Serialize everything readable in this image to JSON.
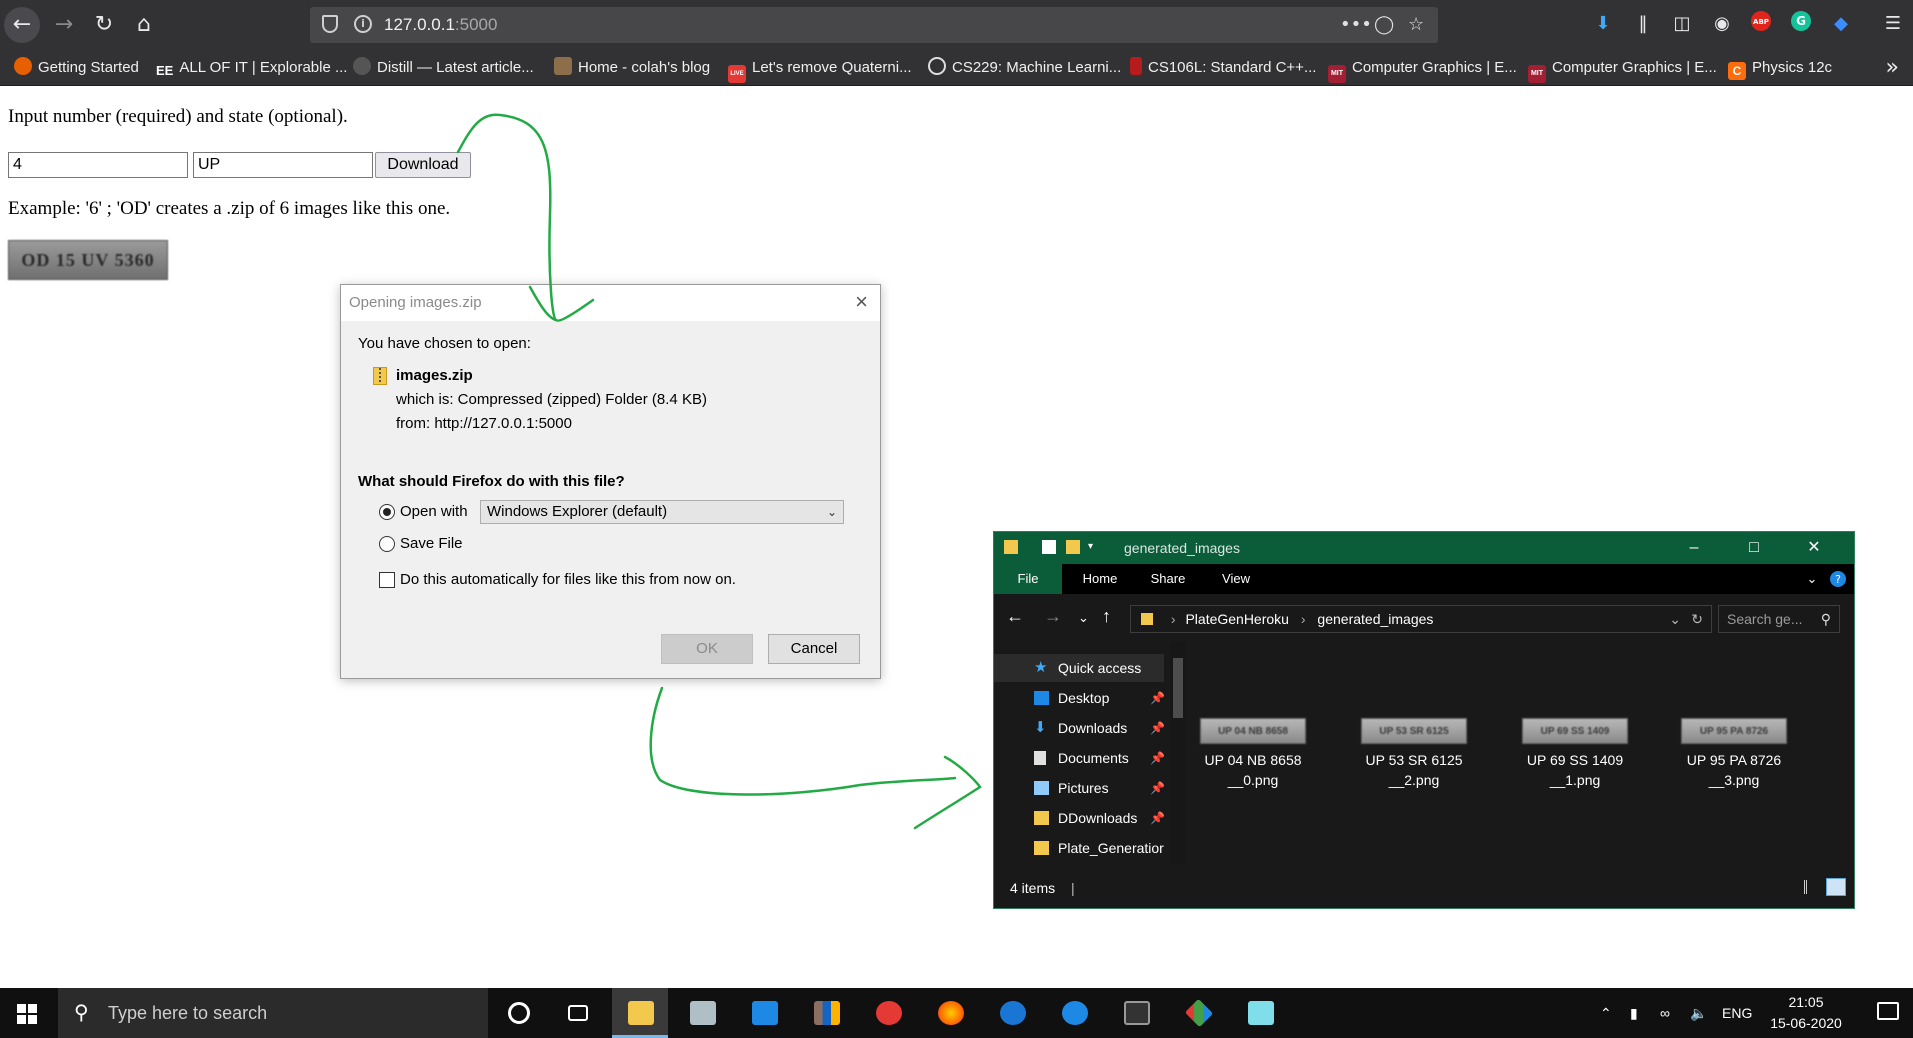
{
  "browser": {
    "url_host": "127.0.0.1",
    "url_port": ":5000",
    "url_actions": "•••",
    "bookmarks": [
      {
        "label": "Getting Started",
        "icon": "firefox-icon",
        "color": "#e66000"
      },
      {
        "label": "ALL OF IT | Explorable ...",
        "icon": "ee-icon",
        "color": "#323234",
        "prefix": "EE"
      },
      {
        "label": "Distill — Latest article...",
        "icon": "distill-icon",
        "color": "#555555"
      },
      {
        "label": "Home - colah's blog",
        "icon": "colah-icon",
        "color": "#8d6e4a"
      },
      {
        "label": "Let's remove Quaterni...",
        "icon": "live-icon",
        "color": "#e53935",
        "prefix": "LIVE"
      },
      {
        "label": "CS229: Machine Learni...",
        "icon": "globe-icon",
        "color": "#555555"
      },
      {
        "label": "CS106L: Standard C++...",
        "icon": "stanford-icon",
        "color": "#b71c1c"
      },
      {
        "label": "Computer Graphics | E...",
        "icon": "mit-icon",
        "color": "#a31f34",
        "prefix": "MIT"
      },
      {
        "label": "Computer Graphics | E...",
        "icon": "mit-icon",
        "color": "#a31f34",
        "prefix": "MIT"
      },
      {
        "label": "Physics 12c",
        "icon": "caltech-icon",
        "color": "#ff6c0c",
        "prefix": "C"
      }
    ]
  },
  "page": {
    "instruction": "Input number (required) and state (optional).",
    "number_value": "4",
    "state_value": "UP",
    "download_label": "Download",
    "example": "Example: '6' ; 'OD' creates a .zip of 6 images like this one.",
    "sample_plate": "OD 15 UV 5360"
  },
  "dialog": {
    "title": "Opening images.zip",
    "chosen": "You have chosen to open:",
    "filename": "images.zip",
    "which_is": "which is: Compressed (zipped) Folder (8.4 KB)",
    "from": "from: http://127.0.0.1:5000",
    "question": "What should Firefox do with this file?",
    "open_with": "Open with",
    "open_with_app": "Windows Explorer (default)",
    "save_file": "Save File",
    "auto": "Do this automatically for files like this from now on.",
    "ok": "OK",
    "cancel": "Cancel"
  },
  "explorer": {
    "title": "generated_images",
    "tabs": [
      "File",
      "Home",
      "Share",
      "View"
    ],
    "path": [
      "PlateGenHeroku",
      "generated_images"
    ],
    "search_placeholder": "Search ge...",
    "sidebar": [
      {
        "label": "Quick access",
        "icon": "star-icon",
        "pinned": false
      },
      {
        "label": "Desktop",
        "icon": "desktop-icon",
        "pinned": true
      },
      {
        "label": "Downloads",
        "icon": "download-arrow-icon",
        "pinned": true
      },
      {
        "label": "Documents",
        "icon": "document-icon",
        "pinned": true
      },
      {
        "label": "Pictures",
        "icon": "pictures-icon",
        "pinned": true
      },
      {
        "label": "DDownloads",
        "icon": "folder-icon",
        "pinned": true
      },
      {
        "label": "Plate_Generatior",
        "icon": "folder-icon",
        "pinned": false
      }
    ],
    "files": [
      {
        "name": "UP 04 NB 8658 __0.png",
        "line1": "UP 04 NB 8658",
        "line2": "__0.png",
        "plate": "UP 04 NB 8658"
      },
      {
        "name": "UP 53 SR 6125 __2.png",
        "line1": "UP 53 SR 6125",
        "line2": "__2.png",
        "plate": "UP 53 SR 6125"
      },
      {
        "name": "UP 69 SS 1409 __1.png",
        "line1": "UP 69 SS 1409",
        "line2": "__1.png",
        "plate": "UP 69 SS 1409"
      },
      {
        "name": "UP 95 PA 8726 __3.png",
        "line1": "UP 95 PA 8726",
        "line2": "__3.png",
        "plate": "UP 95 PA 8726"
      }
    ],
    "status": "4 items"
  },
  "taskbar": {
    "search_placeholder": "Type here to search",
    "lang": "ENG",
    "time": "21:05",
    "date": "15-06-2020"
  },
  "colors": {
    "accent_green": "#22aa44",
    "explorer_title": "#0b5d3a",
    "taskbar_bg": "#101010",
    "browser_chrome": "#323234"
  }
}
